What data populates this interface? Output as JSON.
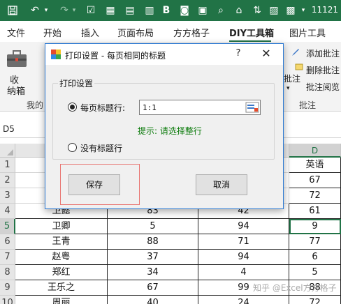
{
  "titlebar": {
    "trailing_text": "11121"
  },
  "ribbon_tabs": [
    {
      "label": "文件"
    },
    {
      "label": "开始"
    },
    {
      "label": "插入"
    },
    {
      "label": "页面布局"
    },
    {
      "label": "方方格子"
    },
    {
      "label": "DIY工具箱"
    },
    {
      "label": "图片工具"
    }
  ],
  "ribbon": {
    "collect_label_1": "收",
    "collect_label_2": "纳箱",
    "mine_label": "我的",
    "comment_label": "批注",
    "add_comment": "添加批注",
    "delete_comment": "删除批注",
    "comment_read": "批注阅览",
    "comment_group": "批注"
  },
  "formula_bar": {
    "name_box": "D5"
  },
  "dialog": {
    "title": "打印设置 - 每页相同的标题",
    "help": "?",
    "close": "✕",
    "group_label": "打印设置",
    "option_per_page": "每页标题行:",
    "input_value": "1:1",
    "hint": "提示: 请选择整行",
    "option_none": "没有标题行",
    "save_label": "保存",
    "cancel_label": "取消"
  },
  "sheet": {
    "column_d": "D",
    "rows": [
      {
        "num": "1",
        "name": "",
        "b": "",
        "c": "",
        "d": "英语"
      },
      {
        "num": "2",
        "name": "",
        "b": "",
        "c": "",
        "d": "67"
      },
      {
        "num": "3",
        "name": "",
        "b": "",
        "c": "",
        "d": "72"
      },
      {
        "num": "4",
        "name": "卫懿",
        "b": "83",
        "c": "42",
        "d": "61"
      },
      {
        "num": "5",
        "name": "卫卿",
        "b": "5",
        "c": "94",
        "d": "9"
      },
      {
        "num": "6",
        "name": "王青",
        "b": "88",
        "c": "71",
        "d": "77"
      },
      {
        "num": "7",
        "name": "赵粤",
        "b": "37",
        "c": "94",
        "d": "6"
      },
      {
        "num": "8",
        "name": "郑红",
        "b": "34",
        "c": "4",
        "d": "5"
      },
      {
        "num": "9",
        "name": "王乐之",
        "b": "67",
        "c": "99",
        "d": "88"
      },
      {
        "num": "10",
        "name": "周丽",
        "b": "40",
        "c": "24",
        "d": "72"
      }
    ]
  },
  "watermark": "知乎 @Excel方方格子",
  "colors": {
    "excel_green": "#217346",
    "hint_green": "#0a7a0a",
    "highlight": "#e8736f"
  }
}
